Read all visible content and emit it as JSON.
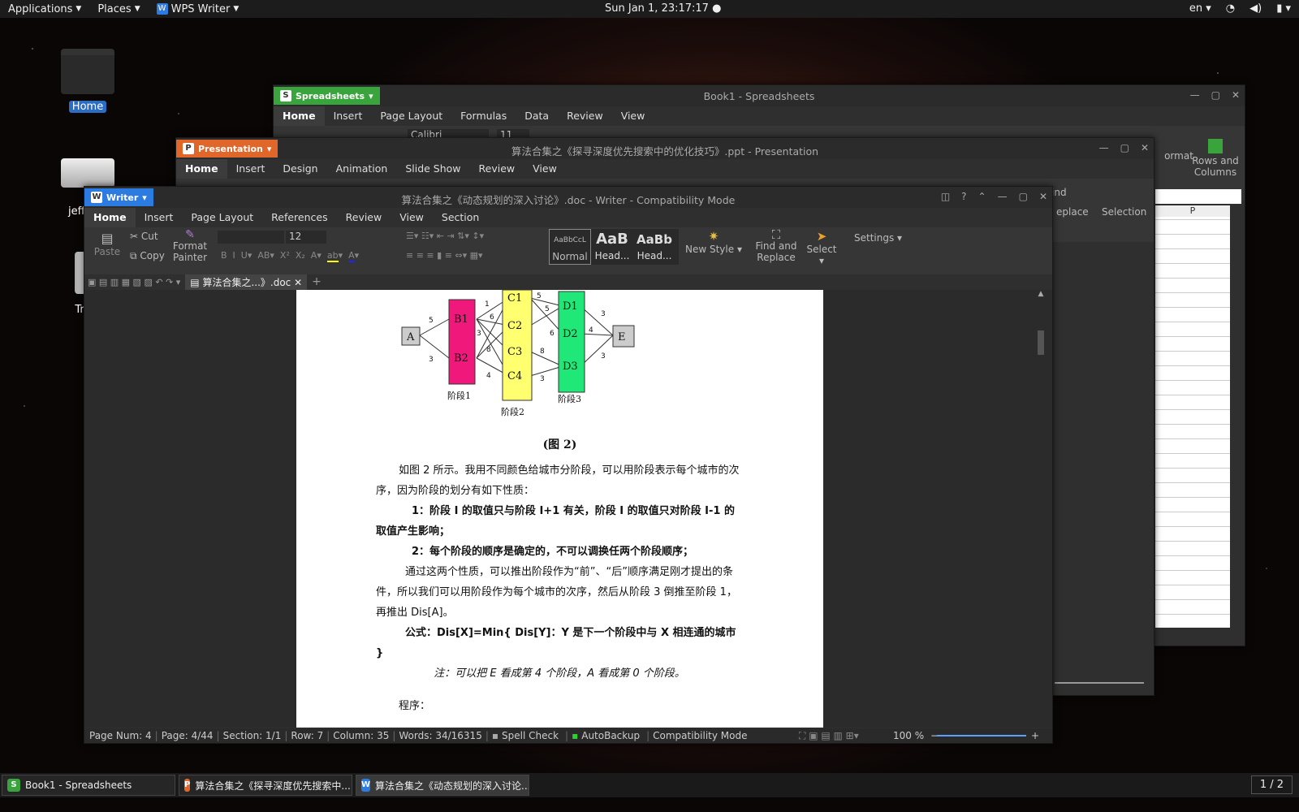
{
  "panel": {
    "applications": "Applications",
    "places": "Places",
    "app": "WPS Writer",
    "clock": "Sun Jan  1, 23:17:17",
    "lang": "en"
  },
  "desktop": {
    "home": "Home",
    "drive": "jeffsw",
    "trash": "Tr"
  },
  "sheet": {
    "app": "Spreadsheets",
    "title": "Book1 - Spreadsheets",
    "menus": [
      "Home",
      "Insert",
      "Page Layout",
      "Formulas",
      "Data",
      "Review",
      "View"
    ],
    "font": "Calibri",
    "size": "11",
    "format": "ormat",
    "rows_cols": "Rows and Columns",
    "col": "P"
  },
  "pres": {
    "app": "Presentation",
    "title": "算法合集之《探寻深度优先搜索中的优化技巧》.ppt - Presentation",
    "menus": [
      "Home",
      "Insert",
      "Design",
      "Animation",
      "Slide Show",
      "Review",
      "View"
    ],
    "find": "Find",
    "replace": "eplace",
    "selection": "Selection"
  },
  "writer": {
    "app": "Writer",
    "title": "算法合集之《动态规划的深入讨论》.doc - Writer - Compatibility Mode",
    "menus": [
      "Home",
      "Insert",
      "Page Layout",
      "References",
      "Review",
      "View",
      "Section"
    ],
    "ribbon": {
      "paste": "Paste",
      "cut": "Cut",
      "copy": "Copy",
      "format_painter": "Format Painter",
      "size": "12",
      "style_normal": "Normal",
      "style_h1": "Head...",
      "style_h2": "Head...",
      "style_prev1": "AaBbCcL",
      "style_prev2": "AaB",
      "style_prev3": "AaBb",
      "new_style": "New Style",
      "find": "Find and Replace",
      "select": "Select",
      "settings": "Settings"
    },
    "tab": "算法合集之...》.doc"
  },
  "doc": {
    "diagram": {
      "A": "A",
      "B1": "B1",
      "B2": "B2",
      "C1": "C1",
      "C2": "C2",
      "C3": "C3",
      "C4": "C4",
      "D1": "D1",
      "D2": "D2",
      "D3": "D3",
      "E": "E",
      "stage1": "阶段1",
      "stage2": "阶段2",
      "stage3": "阶段3",
      "w": [
        "5",
        "3",
        "1",
        "6",
        "3",
        "8",
        "4",
        "5",
        "5",
        "6",
        "8",
        "3",
        "3",
        "4",
        "3"
      ]
    },
    "caption": "(图 2)",
    "p1": "如图 2 所示。我用不同颜色给城市分阶段，可以用阶段表示每个城市的次序，因为阶段的划分有如下性质：",
    "p2": "1：阶段 I 的取值只与阶段 I+1 有关，阶段 I 的取值只对阶段 I-1 的取值产生影响；",
    "p3": "2：每个阶段的顺序是确定的，不可以调换任两个阶段顺序；",
    "p4": "通过这两个性质，可以推出阶段作为“前”、“后”顺序满足刚才提出的条件，所以我们可以用阶段作为每个城市的次序，然后从阶段 3 倒推至阶段 1，再推出 Dis[A]。",
    "p5": "公式：Dis[X]=Min{ Dis[Y]：Y 是下一个阶段中与 X 相连通的城市 }",
    "p6": "注：可以把 E 看成第 4 个阶段，A 看成第 0 个阶段。",
    "p7": "程序："
  },
  "status": {
    "page_num": "Page Num: 4",
    "page": "Page: 4/44",
    "section": "Section: 1/1",
    "row": "Row: 7",
    "column": "Column: 35",
    "words": "Words: 34/16315",
    "spell": "Spell Check",
    "autobackup": "AutoBackup",
    "compat": "Compatibility Mode",
    "zoom": "100 %"
  },
  "taskbar": {
    "t1": "Book1 - Spreadsheets",
    "t2": "算法合集之《探寻深度优先搜索中...",
    "t3": "算法合集之《动态规划的深入讨论...",
    "pager": "1 / 2"
  }
}
